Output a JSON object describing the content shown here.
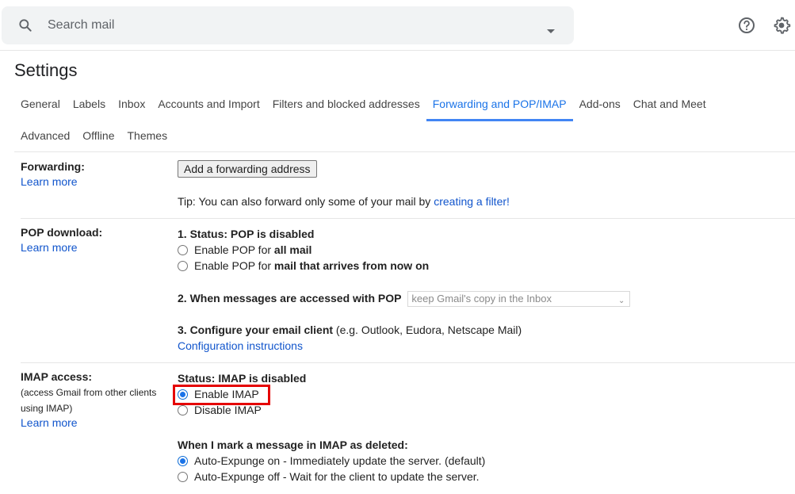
{
  "search": {
    "placeholder": "Search mail",
    "value": ""
  },
  "header": {
    "icons": [
      "search-icon",
      "dropdown-caret-icon",
      "help-icon",
      "settings-gear-icon"
    ]
  },
  "page_title": "Settings",
  "tabs_row1": [
    {
      "label": "General",
      "active": false
    },
    {
      "label": "Labels",
      "active": false
    },
    {
      "label": "Inbox",
      "active": false
    },
    {
      "label": "Accounts and Import",
      "active": false
    },
    {
      "label": "Filters and blocked addresses",
      "active": false
    },
    {
      "label": "Forwarding and POP/IMAP",
      "active": true
    },
    {
      "label": "Add-ons",
      "active": false
    },
    {
      "label": "Chat and Meet",
      "active": false
    }
  ],
  "tabs_row2": [
    {
      "label": "Advanced",
      "active": false
    },
    {
      "label": "Offline",
      "active": false
    },
    {
      "label": "Themes",
      "active": false
    }
  ],
  "accent_color": "#1a73e8",
  "highlight_color": "#e50000",
  "forwarding": {
    "label": "Forwarding:",
    "learn_more": "Learn more",
    "add_button": "Add a forwarding address",
    "tip_prefix": "Tip: You can also forward only some of your mail by ",
    "tip_link": "creating a filter!"
  },
  "pop": {
    "label": "POP download:",
    "learn_more": "Learn more",
    "status": "1. Status: POP is disabled",
    "option1_prefix": "Enable POP for ",
    "option1_bold": "all mail",
    "option2_prefix": "Enable POP for ",
    "option2_bold": "mail that arrives from now on",
    "when_accessed": "2. When messages are accessed with POP",
    "when_accessed_select": "keep Gmail's copy in the Inbox",
    "configure_bold": "3. Configure your email client",
    "configure_rest": " (e.g. Outlook, Eudora, Netscape Mail)",
    "config_link": "Configuration instructions"
  },
  "imap": {
    "label": "IMAP access:",
    "desc": "(access Gmail from other clients using IMAP)",
    "learn_more": "Learn more",
    "status": "Status: IMAP is disabled",
    "enable": "Enable IMAP",
    "disable": "Disable IMAP",
    "enable_checked": true,
    "deleted_heading": "When I mark a message in IMAP as deleted:",
    "expunge_on": "Auto-Expunge on - Immediately update the server. (default)",
    "expunge_off": "Auto-Expunge off - Wait for the client to update the server.",
    "expunge_on_checked": true
  }
}
